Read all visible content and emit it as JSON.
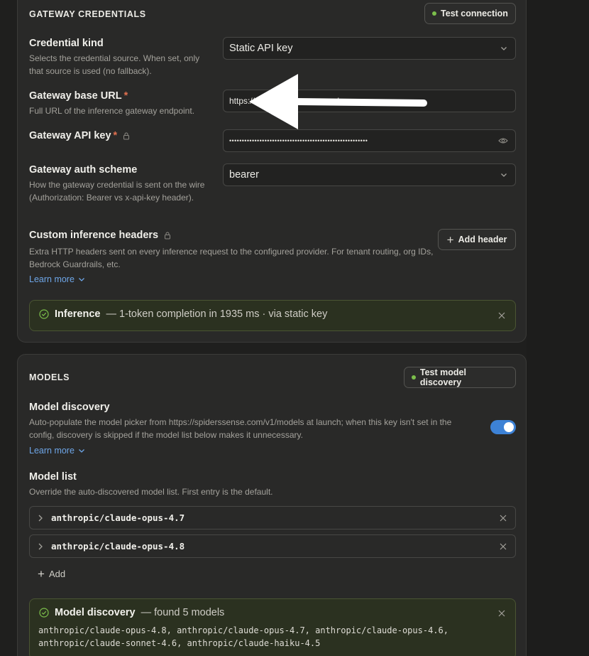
{
  "gateway": {
    "section_title": "GATEWAY CREDENTIALS",
    "test_button": "Test connection",
    "credential_kind": {
      "label": "Credential kind",
      "help": "Selects the credential source. When set, only that source is used (no fallback).",
      "value": "Static API key"
    },
    "base_url": {
      "label": "Gateway base URL",
      "required": "*",
      "help": "Full URL of the inference gateway endpoint.",
      "value": "https://",
      "value_tail": "/"
    },
    "api_key": {
      "label": "Gateway API key",
      "required": "*",
      "value": "•••••••••••••••••••••••••••••••••••••••••••••••••••••••"
    },
    "auth_scheme": {
      "label": "Gateway auth scheme",
      "help": "How the gateway credential is sent on the wire (Authorization: Bearer vs x-api-key header).",
      "value": "bearer"
    },
    "custom_headers": {
      "label": "Custom inference headers",
      "help": "Extra HTTP headers sent on every inference request to the configured provider. For tenant routing, org IDs, Bedrock Guardrails, etc.",
      "add_button": "Add header",
      "learn_more": "Learn more"
    },
    "result": {
      "title": "Inference",
      "detail": "— 1-token completion in 1935 ms · via static key"
    }
  },
  "models": {
    "section_title": "MODELS",
    "test_button": "Test model discovery",
    "discovery": {
      "label": "Model discovery",
      "help": "Auto-populate the model picker from https://spiderssense.com/v1/models at launch; when this key isn't set in the config, discovery is skipped if the model list below makes it unnecessary.",
      "learn_more": "Learn more",
      "enabled": true
    },
    "model_list": {
      "label": "Model list",
      "help": "Override the auto-discovered model list. First entry is the default.",
      "items": [
        "anthropic/claude-opus-4.7",
        "anthropic/claude-opus-4.8"
      ],
      "add_label": "Add"
    },
    "result": {
      "title": "Model discovery",
      "detail": "— found 5 models",
      "line1": "anthropic/claude-opus-4.8, anthropic/claude-opus-4.7, anthropic/claude-opus-4.6,",
      "line2": "anthropic/claude-sonnet-4.6, anthropic/claude-haiku-4.5"
    }
  },
  "colors": {
    "background": "#1f1f1e",
    "card": "#292928",
    "accent_blue": "#3d82d6",
    "success_green": "#7cbf4b",
    "required_red": "#e0704f",
    "link_blue": "#6ea6e8"
  }
}
